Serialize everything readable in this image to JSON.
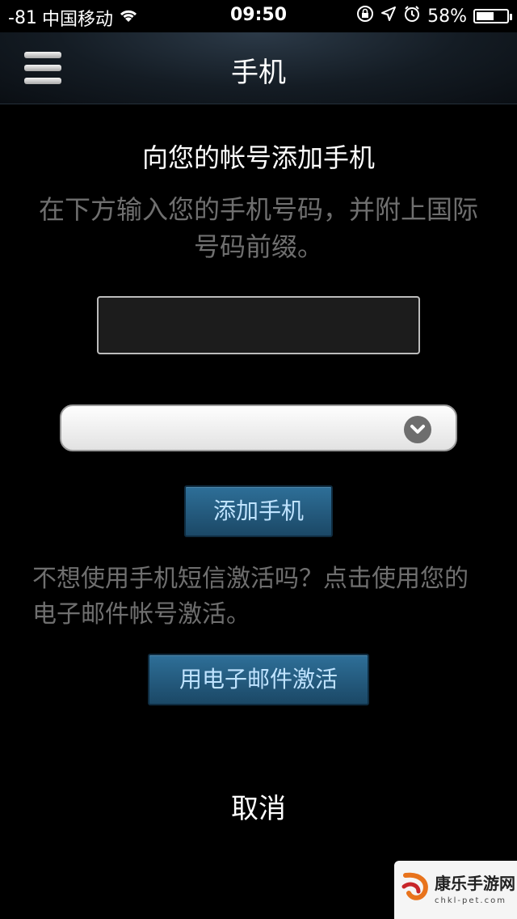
{
  "status_bar": {
    "signal": "-81",
    "carrier": "中国移动",
    "time": "09:50",
    "battery_percent": "58%",
    "battery_level": 0.58,
    "icons": [
      "wifi-icon",
      "rotation-lock-icon",
      "location-icon",
      "alarm-icon",
      "battery-icon"
    ]
  },
  "nav": {
    "title": "手机",
    "menu_icon": "hamburger-menu-icon"
  },
  "content": {
    "heading": "向您的帐号添加手机",
    "instruction": "在下方输入您的手机号码，并附上国际号码前缀。",
    "phone_input": {
      "value": "",
      "placeholder": ""
    },
    "country_select": {
      "selected": ""
    },
    "add_phone_label": "添加手机",
    "alt_text": "不想使用手机短信激活吗？点击使用您的电子邮件帐号激活。",
    "email_button_label": "用电子邮件激活",
    "cancel_label": "取消"
  },
  "watermark": {
    "name": "康乐手游网",
    "url": "chkl-pet.com"
  },
  "colors": {
    "background": "#000000",
    "button_blue": "#2e6f98",
    "button_text": "#bfe3ff",
    "muted_text": "#6f6f6f"
  }
}
